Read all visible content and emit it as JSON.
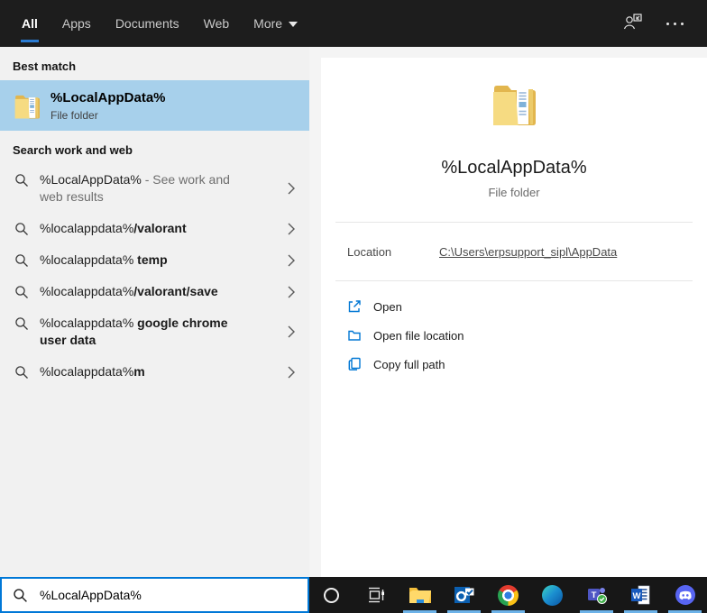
{
  "topbar": {
    "tabs": [
      {
        "label": "All",
        "active": true
      },
      {
        "label": "Apps",
        "active": false
      },
      {
        "label": "Documents",
        "active": false
      },
      {
        "label": "Web",
        "active": false
      },
      {
        "label": "More",
        "active": false,
        "has_dropdown": true
      }
    ],
    "account_icon": "person-feedback-icon",
    "more_options_icon": "ellipsis-icon"
  },
  "left_panel": {
    "best_match_header": "Best match",
    "best_match": {
      "title": "%LocalAppData%",
      "subtitle": "File folder",
      "icon": "folder-icon"
    },
    "web_section_header": "Search work and web",
    "suggestions": [
      {
        "query": "%LocalAppData%",
        "suffix": " - See work and web results"
      },
      {
        "query": "%localappdata%",
        "completion": "/valorant"
      },
      {
        "query": "%localappdata%",
        "completion": " temp"
      },
      {
        "query": "%localappdata%",
        "completion": "/valorant/save"
      },
      {
        "query": "%localappdata%",
        "completion": " google chrome user data"
      },
      {
        "query": "%localappdata%",
        "completion": "m"
      }
    ]
  },
  "detail_panel": {
    "icon": "folder-icon",
    "title": "%LocalAppData%",
    "subtitle": "File folder",
    "location_label": "Location",
    "location_path": "C:\\Users\\erpsupport_sipl\\AppData",
    "actions": [
      {
        "label": "Open",
        "icon": "open-external-icon"
      },
      {
        "label": "Open file location",
        "icon": "folder-outline-icon"
      },
      {
        "label": "Copy full path",
        "icon": "copy-icon"
      }
    ]
  },
  "search_box": {
    "value": "%LocalAppData%",
    "icon": "search-icon"
  },
  "taskbar": {
    "items": [
      {
        "name": "cortana",
        "running": false
      },
      {
        "name": "task-view",
        "running": false
      },
      {
        "name": "file-explorer",
        "running": true
      },
      {
        "name": "outlook",
        "running": true
      },
      {
        "name": "chrome",
        "running": true
      },
      {
        "name": "edge",
        "running": false
      },
      {
        "name": "teams",
        "running": true
      },
      {
        "name": "word",
        "running": true
      },
      {
        "name": "discord",
        "running": true
      }
    ]
  },
  "colors": {
    "accent_blue": "#0078d7",
    "best_match_highlight": "#a7d0eb",
    "topbar_bg": "#1d1d1d",
    "taskbar_bg": "#171717",
    "running_indicator": "#6cb2e8",
    "action_icon_blue": "#0077d4"
  }
}
